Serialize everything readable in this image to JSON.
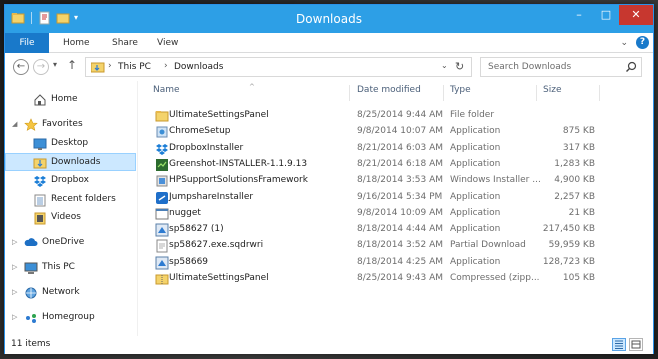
{
  "window": {
    "title": "Downloads"
  },
  "window_controls": {
    "minimize": "–",
    "maximize": "□",
    "close": "✕"
  },
  "ribbon": {
    "tabs": [
      "File",
      "Home",
      "Share",
      "View"
    ]
  },
  "address": {
    "crumbs": [
      "This PC",
      "Downloads"
    ],
    "search_placeholder": "Search Downloads"
  },
  "nav": {
    "items": [
      {
        "label": "Home",
        "icon": "home-icon"
      },
      {
        "label": "Favorites",
        "icon": "star-icon"
      },
      {
        "label": "Desktop",
        "icon": "desktop-icon"
      },
      {
        "label": "Downloads",
        "icon": "downloads-folder-icon"
      },
      {
        "label": "Dropbox",
        "icon": "dropbox-icon"
      },
      {
        "label": "Recent folders",
        "icon": "recent-folders-icon"
      },
      {
        "label": "Videos",
        "icon": "videos-icon"
      },
      {
        "label": "OneDrive",
        "icon": "cloud-icon"
      },
      {
        "label": "This PC",
        "icon": "computer-icon"
      },
      {
        "label": "Network",
        "icon": "network-icon"
      },
      {
        "label": "Homegroup",
        "icon": "homegroup-icon"
      }
    ]
  },
  "columns": {
    "name": "Name",
    "date": "Date modified",
    "type": "Type",
    "size": "Size"
  },
  "files": [
    {
      "name": "UltimateSettingsPanel",
      "date": "8/25/2014 9:44 AM",
      "type": "File folder",
      "size": "",
      "icon": "folder-icon"
    },
    {
      "name": "ChromeSetup",
      "date": "9/8/2014 10:07 AM",
      "type": "Application",
      "size": "875 KB",
      "icon": "installer-icon"
    },
    {
      "name": "DropboxInstaller",
      "date": "8/21/2014 6:03 AM",
      "type": "Application",
      "size": "317 KB",
      "icon": "dropbox-icon"
    },
    {
      "name": "Greenshot-INSTALLER-1.1.9.13",
      "date": "8/21/2014 6:18 AM",
      "type": "Application",
      "size": "1,283 KB",
      "icon": "greenshot-icon"
    },
    {
      "name": "HPSupportSolutionsFramework",
      "date": "8/18/2014 3:53 AM",
      "type": "Windows Installer ...",
      "size": "4,900 KB",
      "icon": "msi-icon"
    },
    {
      "name": "JumpshareInstaller",
      "date": "9/16/2014 5:34 PM",
      "type": "Application",
      "size": "2,257 KB",
      "icon": "jumpshare-icon"
    },
    {
      "name": "nugget",
      "date": "9/8/2014 10:09 AM",
      "type": "Application",
      "size": "21 KB",
      "icon": "app-icon"
    },
    {
      "name": "sp58627 (1)",
      "date": "8/18/2014 4:44 AM",
      "type": "Application",
      "size": "217,450 KB",
      "icon": "setup-icon"
    },
    {
      "name": "sp58627.exe.sqdrwri",
      "date": "8/18/2014 3:52 AM",
      "type": "Partial Download",
      "size": "59,959 KB",
      "icon": "partial-download-icon"
    },
    {
      "name": "sp58669",
      "date": "8/18/2014 4:25 AM",
      "type": "Application",
      "size": "128,723 KB",
      "icon": "setup-icon"
    },
    {
      "name": "UltimateSettingsPanel",
      "date": "8/25/2014 9:43 AM",
      "type": "Compressed (zipp...",
      "size": "105 KB",
      "icon": "zip-folder-icon"
    }
  ],
  "status": {
    "count": "11 items"
  },
  "colors": {
    "titlebar": "#2d9fe6",
    "file_tab": "#1979ca",
    "selection": "#cce8ff",
    "close": "#c7372f"
  }
}
